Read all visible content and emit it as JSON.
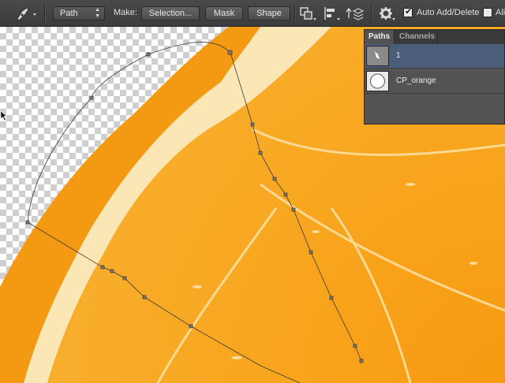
{
  "options_bar": {
    "tool_icon": "pen-icon",
    "mode_dropdown": "Path",
    "make_label": "Make:",
    "selection_button": "Selection...",
    "mask_button": "Mask",
    "shape_button": "Shape",
    "path_operations_icon": "path-operations-icon",
    "path_alignment_icon": "path-alignment-icon",
    "path_arrangement_icon": "path-arrangement-icon",
    "settings_icon": "gear-icon",
    "auto_add_delete_label": "Auto Add/Delete",
    "auto_add_delete_checked": true,
    "align_edges_label": "Ali",
    "align_edges_checked": false
  },
  "paths_panel": {
    "tabs": [
      {
        "label": "Paths",
        "active": true
      },
      {
        "label": "Channels",
        "active": false
      }
    ],
    "items": [
      {
        "name": "1",
        "selected": true
      },
      {
        "name": "CP_orange",
        "selected": false
      }
    ]
  },
  "colors": {
    "orange_flesh": "#f7a21e",
    "peel": "#f49d16",
    "pith": "#fbe7bb",
    "selected_row": "#4a5e7a"
  }
}
